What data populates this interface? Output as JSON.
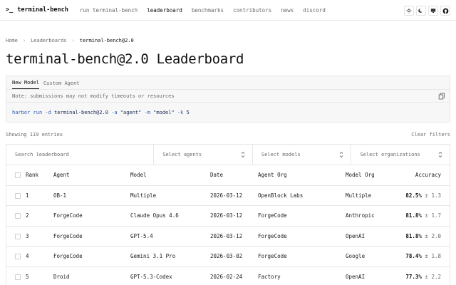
{
  "nav": {
    "brand_prompt": ">_",
    "brand": "terminal-bench",
    "links": [
      "run terminal-bench",
      "leaderboard",
      "benchmarks",
      "contributors",
      "news",
      "discord"
    ],
    "active": "leaderboard"
  },
  "breadcrumb": [
    "Home",
    "Leaderboards",
    "terminal-bench@2.0"
  ],
  "title": "terminal-bench@2.0 Leaderboard",
  "command": {
    "tabs": [
      "New Model",
      "Custom Agent"
    ],
    "note": "Note: submissions may not modify timeouts or resources",
    "parts": [
      "harbor",
      "run",
      "-d",
      "terminal-bench@2.0",
      "-a",
      "\"agent\"",
      "-m",
      "\"model\"",
      "-k",
      "5"
    ]
  },
  "toolbar": {
    "showing": "Showing 119 entries",
    "clear": "Clear filters"
  },
  "filters": {
    "search_placeholder": "Search leaderboard",
    "agents": "Select agents",
    "models": "Select models",
    "orgs": "Select organizations"
  },
  "table": {
    "headers": [
      "Rank",
      "Agent",
      "Model",
      "Date",
      "Agent Org",
      "Model Org",
      "Accuracy"
    ],
    "rows": [
      {
        "rank": "1",
        "agent": "OB-1",
        "model": "Multiple",
        "date": "2026-03-12",
        "agent_org": "OpenBlock Labs",
        "model_org": "Multiple",
        "acc": "82.5%",
        "err": "± 1.3"
      },
      {
        "rank": "2",
        "agent": "ForgeCode",
        "model": "Claude Opus 4.6",
        "date": "2026-03-12",
        "agent_org": "ForgeCode",
        "model_org": "Anthropic",
        "acc": "81.8%",
        "err": "± 1.7"
      },
      {
        "rank": "3",
        "agent": "ForgeCode",
        "model": "GPT-5.4",
        "date": "2026-03-12",
        "agent_org": "ForgeCode",
        "model_org": "OpenAI",
        "acc": "81.8%",
        "err": "± 2.0"
      },
      {
        "rank": "4",
        "agent": "ForgeCode",
        "model": "Gemini 3.1 Pro",
        "date": "2026-03-02",
        "agent_org": "ForgeCode",
        "model_org": "Google",
        "acc": "78.4%",
        "err": "± 1.8"
      },
      {
        "rank": "5",
        "agent": "Droid",
        "model": "GPT-5.3-Codex",
        "date": "2026-02-24",
        "agent_org": "Factory",
        "model_org": "OpenAI",
        "acc": "77.3%",
        "err": "± 2.2"
      }
    ]
  },
  "icons": [
    "sun-icon",
    "moon-icon",
    "monitor-icon",
    "github-icon",
    "copy-icon",
    "chevron-updown-icon"
  ]
}
